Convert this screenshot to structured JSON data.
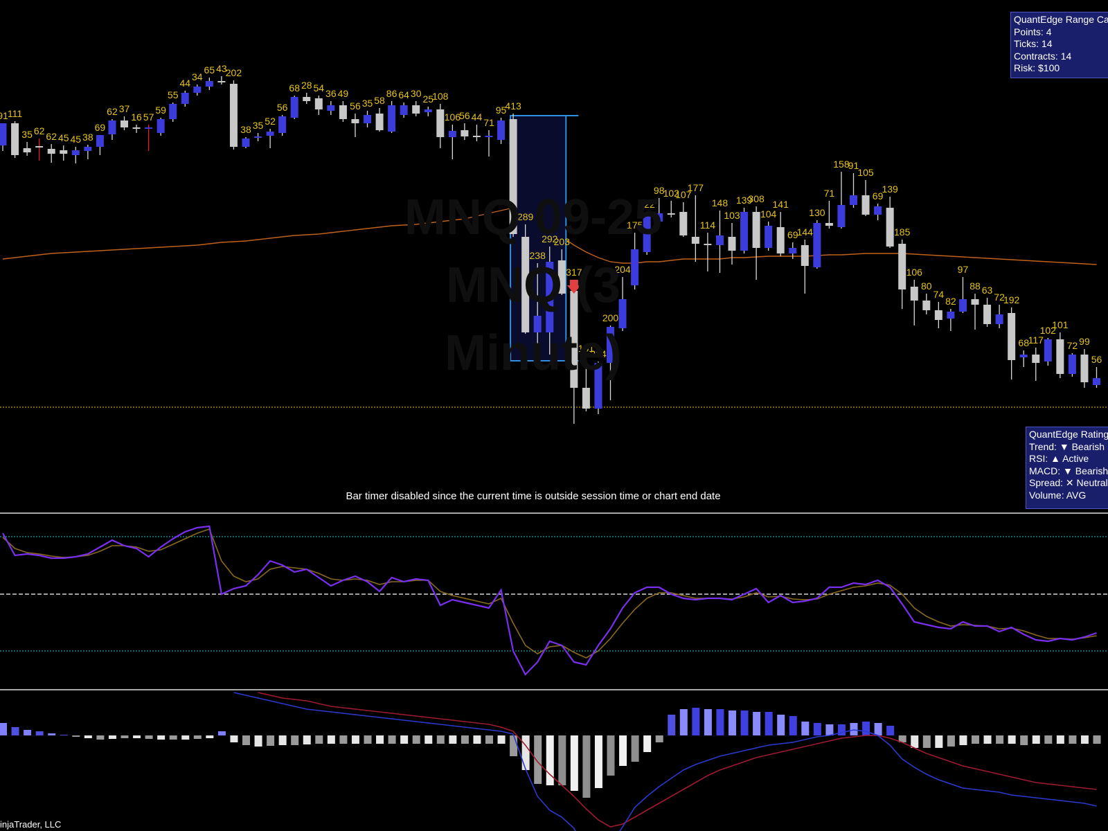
{
  "watermark": {
    "line1": "MNQ 09-25",
    "line2": "MNQ (3 Minute)"
  },
  "range_calc": {
    "title": "QuantEdge Range Calc",
    "points": "Points: 4",
    "ticks": "Ticks: 14",
    "contracts": "Contracts: 14",
    "risk": "Risk: $100"
  },
  "ratings": {
    "title": "QuantEdge Ratings",
    "trend": "Trend: ▼ Bearish",
    "rsi": "RSI: ▲ Active",
    "macd": "MACD: ▼ Bearish",
    "spread": "Spread: ✕ Neutral",
    "volume": "Volume: AVG"
  },
  "bar_timer_text": "Bar timer disabled since the current time is outside session time or chart end date",
  "copyright": "injaTrader, LLC",
  "colors": {
    "background": "#000000",
    "bull_candle": "#3c3cdc",
    "bear_candle": "#c8c8c8",
    "volume_label": "#e6c21c",
    "ema": "#c0621a",
    "level_line": "#c8a000",
    "rsi_line": "#7a2ff0",
    "rsi_signal": "#8a6a1e",
    "rsi_band": "#1fa0a0",
    "macd_line": "#2a3ad0",
    "macd_signal": "#a01a30"
  },
  "chart_data": {
    "type": "candlestick",
    "candles": [
      {
        "o": 210,
        "h": 178,
        "l": 218,
        "c": 178,
        "v": "91"
      },
      {
        "o": 178,
        "h": 175,
        "l": 228,
        "c": 224,
        "v": "111"
      },
      {
        "o": 214,
        "h": 205,
        "l": 225,
        "c": 220,
        "v": "35"
      },
      {
        "o": 211,
        "h": 200,
        "l": 232,
        "c": 213,
        "v": "62"
      },
      {
        "o": 215,
        "h": 208,
        "l": 235,
        "c": 222,
        "v": "62"
      },
      {
        "o": 217,
        "h": 210,
        "l": 232,
        "c": 222,
        "v": "45"
      },
      {
        "o": 224,
        "h": 212,
        "l": 236,
        "c": 217,
        "v": "45"
      },
      {
        "o": 218,
        "h": 209,
        "l": 230,
        "c": 212,
        "v": "38"
      },
      {
        "o": 212,
        "h": 195,
        "l": 224,
        "c": 195,
        "v": "69"
      },
      {
        "o": 194,
        "h": 172,
        "l": 202,
        "c": 174,
        "v": "62"
      },
      {
        "o": 174,
        "h": 168,
        "l": 188,
        "c": 184,
        "v": "37"
      },
      {
        "o": 184,
        "h": 180,
        "l": 192,
        "c": 186,
        "v": "16"
      },
      {
        "o": 186,
        "h": 180,
        "l": 218,
        "c": 184,
        "v": "57"
      },
      {
        "o": 192,
        "h": 170,
        "l": 196,
        "c": 172,
        "v": "59"
      },
      {
        "o": 172,
        "h": 148,
        "l": 176,
        "c": 150,
        "v": "55"
      },
      {
        "o": 150,
        "h": 131,
        "l": 154,
        "c": 134,
        "v": "44"
      },
      {
        "o": 134,
        "h": 122,
        "l": 138,
        "c": 125,
        "v": "34"
      },
      {
        "o": 125,
        "h": 112,
        "l": 130,
        "c": 117,
        "v": "65"
      },
      {
        "o": 117,
        "h": 110,
        "l": 122,
        "c": 119,
        "v": "43"
      },
      {
        "o": 121,
        "h": 116,
        "l": 216,
        "c": 212,
        "v": "202"
      },
      {
        "o": 212,
        "h": 198,
        "l": 214,
        "c": 200,
        "v": "38"
      },
      {
        "o": 198,
        "h": 192,
        "l": 204,
        "c": 197,
        "v": "35"
      },
      {
        "o": 196,
        "h": 186,
        "l": 214,
        "c": 190,
        "v": "52"
      },
      {
        "o": 192,
        "h": 166,
        "l": 196,
        "c": 168,
        "v": "56"
      },
      {
        "o": 170,
        "h": 138,
        "l": 172,
        "c": 140,
        "v": "68"
      },
      {
        "o": 140,
        "h": 134,
        "l": 150,
        "c": 146,
        "v": "28"
      },
      {
        "o": 142,
        "h": 138,
        "l": 166,
        "c": 158,
        "v": "54"
      },
      {
        "o": 160,
        "h": 146,
        "l": 166,
        "c": 152,
        "v": "36"
      },
      {
        "o": 152,
        "h": 146,
        "l": 176,
        "c": 172,
        "v": "49"
      },
      {
        "o": 172,
        "h": 164,
        "l": 198,
        "c": 178,
        "v": "56"
      },
      {
        "o": 178,
        "h": 160,
        "l": 184,
        "c": 166,
        "v": "35"
      },
      {
        "o": 164,
        "h": 156,
        "l": 190,
        "c": 188,
        "v": "58"
      },
      {
        "o": 190,
        "h": 146,
        "l": 192,
        "c": 152,
        "v": "86"
      },
      {
        "o": 166,
        "h": 148,
        "l": 170,
        "c": 152,
        "v": "64"
      },
      {
        "o": 152,
        "h": 146,
        "l": 168,
        "c": 164,
        "v": "30"
      },
      {
        "o": 162,
        "h": 154,
        "l": 168,
        "c": 158,
        "v": "25"
      },
      {
        "o": 158,
        "h": 150,
        "l": 214,
        "c": 198,
        "v": "108"
      },
      {
        "o": 198,
        "h": 180,
        "l": 230,
        "c": 189,
        "v": "106"
      },
      {
        "o": 188,
        "h": 178,
        "l": 202,
        "c": 197,
        "v": "56"
      },
      {
        "o": 196,
        "h": 180,
        "l": 204,
        "c": 198,
        "v": "44"
      },
      {
        "o": 198,
        "h": 188,
        "l": 226,
        "c": 196,
        "v": "71"
      },
      {
        "o": 202,
        "h": 170,
        "l": 208,
        "c": 174,
        "v": "95"
      },
      {
        "o": 172,
        "h": 164,
        "l": 342,
        "c": 338,
        "v": "413"
      },
      {
        "o": 342,
        "h": 324,
        "l": 482,
        "c": 480,
        "v": "289"
      },
      {
        "o": 480,
        "h": 380,
        "l": 518,
        "c": 456,
        "v": "238"
      },
      {
        "o": 480,
        "h": 356,
        "l": 512,
        "c": 378,
        "v": "292"
      },
      {
        "o": 376,
        "h": 360,
        "l": 426,
        "c": 424,
        "v": "203"
      },
      {
        "o": 420,
        "h": 404,
        "l": 612,
        "c": 560,
        "v": "317"
      },
      {
        "o": 560,
        "h": 514,
        "l": 594,
        "c": 590,
        "v": "151"
      },
      {
        "o": 590,
        "h": 522,
        "l": 598,
        "c": 524,
        "v": "214"
      },
      {
        "o": 524,
        "h": 470,
        "l": 578,
        "c": 472,
        "v": "200"
      },
      {
        "o": 474,
        "h": 400,
        "l": 478,
        "c": 432,
        "v": "204"
      },
      {
        "o": 412,
        "h": 336,
        "l": 418,
        "c": 360,
        "v": "175"
      },
      {
        "o": 364,
        "h": 306,
        "l": 368,
        "c": 310,
        "v": "122"
      },
      {
        "o": 320,
        "h": 286,
        "l": 324,
        "c": 308,
        "v": "98"
      },
      {
        "o": 308,
        "h": 290,
        "l": 314,
        "c": 308,
        "v": "102"
      },
      {
        "o": 306,
        "h": 292,
        "l": 342,
        "c": 340,
        "v": "107"
      },
      {
        "o": 342,
        "h": 282,
        "l": 378,
        "c": 352,
        "v": "177"
      },
      {
        "o": 352,
        "h": 336,
        "l": 392,
        "c": 354,
        "v": "114"
      },
      {
        "o": 354,
        "h": 304,
        "l": 394,
        "c": 340,
        "v": "148"
      },
      {
        "o": 342,
        "h": 322,
        "l": 382,
        "c": 362,
        "v": "103"
      },
      {
        "o": 362,
        "h": 300,
        "l": 366,
        "c": 306,
        "v": "139"
      },
      {
        "o": 306,
        "h": 298,
        "l": 404,
        "c": 358,
        "v": "308"
      },
      {
        "o": 358,
        "h": 320,
        "l": 362,
        "c": 326,
        "v": "104"
      },
      {
        "o": 328,
        "h": 306,
        "l": 370,
        "c": 366,
        "v": "141"
      },
      {
        "o": 366,
        "h": 350,
        "l": 374,
        "c": 358,
        "v": "69"
      },
      {
        "o": 354,
        "h": 346,
        "l": 424,
        "c": 384,
        "v": "144"
      },
      {
        "o": 386,
        "h": 318,
        "l": 388,
        "c": 322,
        "v": "130"
      },
      {
        "o": 322,
        "h": 290,
        "l": 330,
        "c": 326,
        "v": "71"
      },
      {
        "o": 328,
        "h": 248,
        "l": 330,
        "c": 296,
        "v": "158"
      },
      {
        "o": 296,
        "h": 250,
        "l": 300,
        "c": 282,
        "v": "91"
      },
      {
        "o": 282,
        "h": 260,
        "l": 312,
        "c": 310,
        "v": "105"
      },
      {
        "o": 310,
        "h": 294,
        "l": 318,
        "c": 298,
        "v": "69"
      },
      {
        "o": 300,
        "h": 284,
        "l": 358,
        "c": 356,
        "v": "139"
      },
      {
        "o": 352,
        "h": 346,
        "l": 446,
        "c": 418,
        "v": "185"
      },
      {
        "o": 414,
        "h": 404,
        "l": 470,
        "c": 434,
        "v": "106"
      },
      {
        "o": 434,
        "h": 424,
        "l": 454,
        "c": 448,
        "v": "80"
      },
      {
        "o": 448,
        "h": 436,
        "l": 474,
        "c": 462,
        "v": "74"
      },
      {
        "o": 460,
        "h": 446,
        "l": 478,
        "c": 450,
        "v": "82"
      },
      {
        "o": 450,
        "h": 400,
        "l": 452,
        "c": 432,
        "v": "97"
      },
      {
        "o": 432,
        "h": 424,
        "l": 476,
        "c": 440,
        "v": "88"
      },
      {
        "o": 440,
        "h": 430,
        "l": 472,
        "c": 468,
        "v": "63"
      },
      {
        "o": 468,
        "h": 440,
        "l": 474,
        "c": 454,
        "v": "72"
      },
      {
        "o": 452,
        "h": 444,
        "l": 548,
        "c": 520,
        "v": "192"
      },
      {
        "o": 516,
        "h": 506,
        "l": 530,
        "c": 512,
        "v": "68"
      },
      {
        "o": 512,
        "h": 502,
        "l": 550,
        "c": 524,
        "v": "117"
      },
      {
        "o": 522,
        "h": 488,
        "l": 528,
        "c": 490,
        "v": "102"
      },
      {
        "o": 490,
        "h": 480,
        "l": 546,
        "c": 540,
        "v": "101"
      },
      {
        "o": 540,
        "h": 510,
        "l": 544,
        "c": 512,
        "v": "72"
      },
      {
        "o": 512,
        "h": 504,
        "l": 560,
        "c": 552,
        "v": "99"
      },
      {
        "o": 556,
        "h": 530,
        "l": 560,
        "c": 546,
        "v": "56"
      }
    ],
    "range_box_candles": [
      42,
      46
    ],
    "signal_arrow_candle": 47,
    "rsi_bands": [
      775,
      858,
      940
    ],
    "rsi": [
      770,
      802,
      800,
      802,
      806,
      806,
      804,
      800,
      790,
      780,
      788,
      792,
      804,
      790,
      778,
      768,
      762,
      760,
      858,
      850,
      846,
      830,
      810,
      816,
      826,
      822,
      834,
      846,
      838,
      832,
      840,
      854,
      834,
      840,
      836,
      838,
      874,
      866,
      870,
      874,
      878,
      852,
      940,
      974,
      956,
      926,
      932,
      956,
      960,
      932,
      908,
      878,
      856,
      848,
      848,
      858,
      864,
      866,
      864,
      864,
      866,
      858,
      850,
      870,
      860,
      870,
      868,
      864,
      848,
      848,
      842,
      844,
      838,
      848,
      872,
      898,
      902,
      906,
      908,
      898,
      904,
      904,
      912,
      906,
      916,
      924,
      926,
      922,
      924,
      920,
      914
    ],
    "rsi_signal": [
      776,
      792,
      798,
      800,
      803,
      805,
      804,
      802,
      796,
      788,
      788,
      790,
      796,
      794,
      786,
      778,
      770,
      764,
      810,
      832,
      840,
      836,
      822,
      818,
      820,
      822,
      828,
      836,
      838,
      836,
      838,
      844,
      840,
      840,
      838,
      838,
      854,
      860,
      864,
      868,
      872,
      864,
      900,
      932,
      944,
      934,
      932,
      942,
      950,
      940,
      922,
      900,
      880,
      864,
      856,
      856,
      860,
      864,
      864,
      864,
      865,
      862,
      856,
      862,
      861,
      865,
      866,
      865,
      858,
      853,
      848,
      846,
      842,
      845,
      858,
      878,
      890,
      898,
      904,
      902,
      903,
      904,
      908,
      907,
      911,
      917,
      922,
      922,
      923,
      921,
      918
    ],
    "macd_zero": 1062,
    "macd_hist": [
      -18,
      -12,
      -8,
      -6,
      -3,
      -1,
      2,
      4,
      6,
      5,
      4,
      4,
      5,
      6,
      6,
      6,
      5,
      4,
      -6,
      10,
      14,
      16,
      15,
      14,
      14,
      13,
      12,
      12,
      12,
      12,
      12,
      12,
      12,
      12,
      12,
      12,
      12,
      12,
      12,
      12,
      12,
      12,
      30,
      50,
      70,
      72,
      72,
      80,
      90,
      76,
      58,
      44,
      38,
      24,
      10,
      -30,
      -38,
      -40,
      -38,
      -38,
      -36,
      -36,
      -34,
      -34,
      -30,
      -28,
      -20,
      -18,
      -16,
      -16,
      -18,
      -20,
      -18,
      -14,
      10,
      18,
      18,
      18,
      16,
      14,
      12,
      12,
      12,
      12,
      14,
      12,
      12,
      12,
      12,
      12,
      12
    ],
    "macd_line": [
      null,
      null,
      null,
      null,
      null,
      null,
      null,
      null,
      null,
      null,
      null,
      null,
      null,
      null,
      null,
      null,
      null,
      null,
      null,
      1000,
      1004,
      1008,
      1012,
      1016,
      1020,
      1024,
      1026,
      1028,
      1030,
      1032,
      1034,
      1036,
      1038,
      1040,
      1042,
      1044,
      1046,
      1048,
      1050,
      1052,
      1054,
      1056,
      1060,
      1110,
      1150,
      1170,
      1180,
      1196,
      1230,
      1250,
      1222,
      1194,
      1166,
      1150,
      1136,
      1124,
      1112,
      1104,
      1098,
      1092,
      1088,
      1084,
      1080,
      1076,
      1074,
      1072,
      1068,
      1064,
      1062,
      1058,
      1054,
      1056,
      1062,
      1076,
      1096,
      1108,
      1118,
      1126,
      1132,
      1138,
      1140,
      1142,
      1144,
      1148,
      1150,
      1152,
      1154,
      1156,
      1158,
      1160,
      1164
    ],
    "macd_signal": [
      null,
      null,
      null,
      null,
      null,
      null,
      null,
      null,
      null,
      null,
      null,
      null,
      null,
      null,
      null,
      null,
      null,
      null,
      null,
      null,
      null,
      1000,
      1004,
      1008,
      1010,
      1012,
      1016,
      1020,
      1022,
      1024,
      1026,
      1028,
      1030,
      1032,
      1034,
      1036,
      1038,
      1040,
      1042,
      1044,
      1046,
      1050,
      1056,
      1076,
      1100,
      1118,
      1134,
      1150,
      1168,
      1184,
      1194,
      1190,
      1180,
      1170,
      1160,
      1150,
      1140,
      1130,
      1120,
      1112,
      1106,
      1100,
      1094,
      1090,
      1086,
      1082,
      1078,
      1074,
      1070,
      1066,
      1064,
      1062,
      1062,
      1066,
      1072,
      1080,
      1088,
      1094,
      1100,
      1106,
      1110,
      1114,
      1118,
      1122,
      1126,
      1130,
      1132,
      1134,
      1136,
      1138,
      1140
    ],
    "ema": [
      374,
      372,
      370,
      368,
      366,
      365,
      364,
      363,
      362,
      361,
      360,
      359,
      358,
      357,
      356,
      355,
      354,
      352,
      350,
      349,
      348,
      346,
      344,
      342,
      340,
      339,
      338,
      336,
      334,
      332,
      330,
      328,
      326,
      325,
      324,
      322,
      320,
      318,
      316,
      312,
      308,
      304,
      300,
      306,
      318,
      330,
      342,
      354,
      364,
      372,
      378,
      380,
      380,
      378,
      378,
      376,
      374,
      374,
      374,
      374,
      372,
      372,
      371,
      370,
      370,
      370,
      370,
      369,
      368,
      368,
      367,
      366,
      366,
      366,
      366,
      367,
      368,
      369,
      370,
      371,
      372,
      373,
      374,
      375,
      376,
      377,
      378,
      379,
      380,
      381,
      382
    ]
  }
}
